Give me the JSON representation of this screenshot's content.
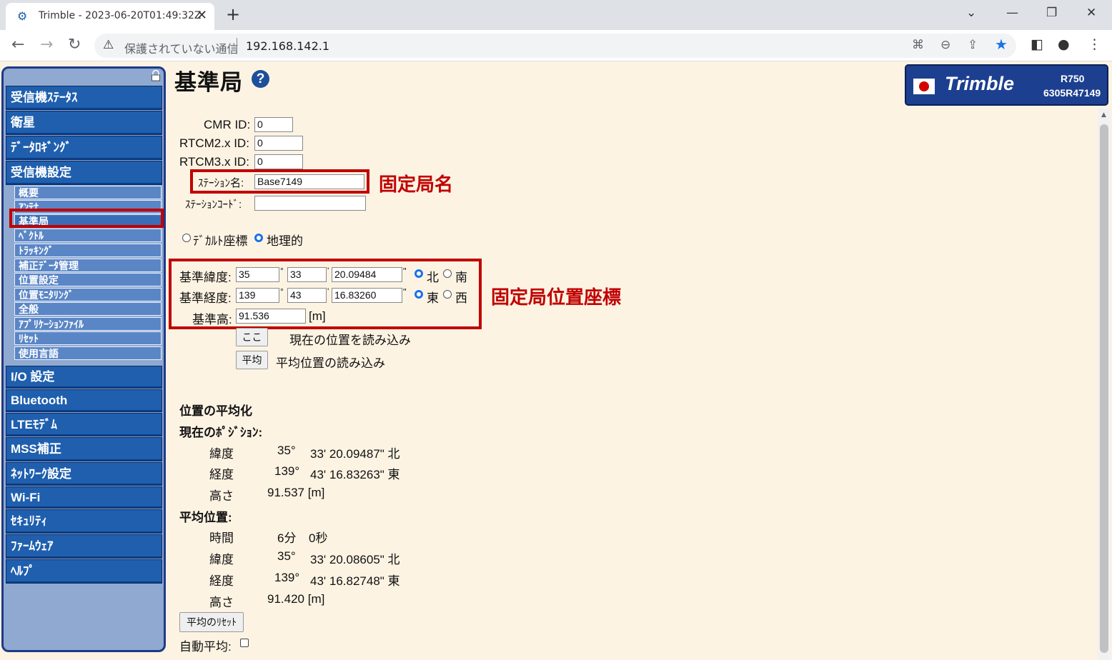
{
  "browser": {
    "tab_title": "Trimble - 2023-06-20T01:49:32Z",
    "close_glyph": "✕",
    "new_tab_glyph": "+",
    "insecure_label": "保護されていない通信",
    "url": "192.168.142.1"
  },
  "sidebar": {
    "menus": [
      {
        "label": "受信機ｽﾃｰﾀｽ"
      },
      {
        "label": "衛星"
      },
      {
        "label": "ﾃﾞｰﾀﾛｷﾞﾝｸﾞ"
      },
      {
        "label": "受信機設定"
      },
      {
        "label": "I/O 設定"
      },
      {
        "label": "Bluetooth"
      },
      {
        "label": "LTEﾓﾃﾞﾑ"
      },
      {
        "label": "MSS補正"
      },
      {
        "label": "ﾈｯﾄﾜｰｸ設定"
      },
      {
        "label": "Wi-Fi"
      },
      {
        "label": "ｾｷｭﾘﾃｨ"
      },
      {
        "label": "ﾌｧｰﾑｳｪｱ"
      },
      {
        "label": "ﾍﾙﾌﾟ"
      }
    ],
    "submenus": [
      {
        "label": "概要"
      },
      {
        "label": "ｱﾝﾃﾅ"
      },
      {
        "label": "基準局"
      },
      {
        "label": "ﾍﾞｸﾄﾙ"
      },
      {
        "label": "ﾄﾗｯｷﾝｸﾞ"
      },
      {
        "label": "補正ﾃﾞｰﾀ管理"
      },
      {
        "label": "位置設定"
      },
      {
        "label": "位置ﾓﾆﾀﾘﾝｸﾞ"
      },
      {
        "label": "全般"
      },
      {
        "label": "ｱﾌﾟﾘｹｰｼｮﾝﾌｧｲﾙ"
      },
      {
        "label": "ﾘｾｯﾄ"
      },
      {
        "label": "使用言語"
      }
    ]
  },
  "page": {
    "title": "基準局",
    "help_glyph": "?",
    "cmr_label": "CMR ID:",
    "cmr_value": "0",
    "rtcm2_label": "RTCM2.x ID:",
    "rtcm2_value": "0",
    "rtcm3_label": "RTCM3.x ID:",
    "rtcm3_value": "0",
    "station_name_label": "ｽﾃｰｼｮﾝ名:",
    "station_name_value": "Base7149",
    "station_code_label": "ｽﾃｰｼｮﾝｺｰﾄﾞ:",
    "station_code_value": "",
    "coord_cartesian": "ﾃﾞｶﾙﾄ座標",
    "coord_geographic": "地理的",
    "lat_label": "基準緯度:",
    "lat_deg": "35",
    "lat_min": "33",
    "lat_sec": "20.09484",
    "lon_label": "基準経度:",
    "lon_deg": "139",
    "lon_min": "43",
    "lon_sec": "16.83260",
    "height_label": "基準高:",
    "height_value": "91.536",
    "unit_m": "[m]",
    "deg_mark": "°",
    "min_mark": "'",
    "sec_mark": "\"",
    "north": "北",
    "south": "南",
    "east": "東",
    "west": "西",
    "here_button": "ここ",
    "here_desc": "現在の位置を読み込み",
    "avg_button": "平均",
    "avg_desc": "平均位置の読み込み",
    "averaging_heading": "位置の平均化",
    "current_heading": "現在のﾎﾟｼﾞｼｮﾝ:",
    "current": {
      "lat_label": "緯度",
      "lat_deg": "35°",
      "lat_rest": "33' 20.09487\" 北",
      "lon_label": "経度",
      "lon_deg": "139°",
      "lon_rest": "43' 16.83263\" 東",
      "h_label": "高さ",
      "h_value": "91.537 [m]"
    },
    "avg_heading": "平均位置:",
    "average": {
      "time_label": "時間",
      "time_min": "6分",
      "time_sec": "0秒",
      "lat_label": "緯度",
      "lat_deg": "35°",
      "lat_rest": "33' 20.08605\" 北",
      "lon_label": "経度",
      "lon_deg": "139°",
      "lon_rest": "43' 16.82748\" 東",
      "h_label": "高さ",
      "h_value": "91.420 [m]"
    },
    "reset_avg_button": "平均のﾘｾｯﾄ",
    "auto_avg_label": "自動平均:"
  },
  "annotations": {
    "station_name_note": "固定局名",
    "position_note": "固定局位置座標"
  },
  "brand": {
    "logo": "Trimble",
    "model": "R750",
    "serial": "6305R47149"
  },
  "colors": {
    "page_bg": "#fdf3e3",
    "menu_blue": "#1f5fae",
    "highlight_red": "#c00000"
  }
}
